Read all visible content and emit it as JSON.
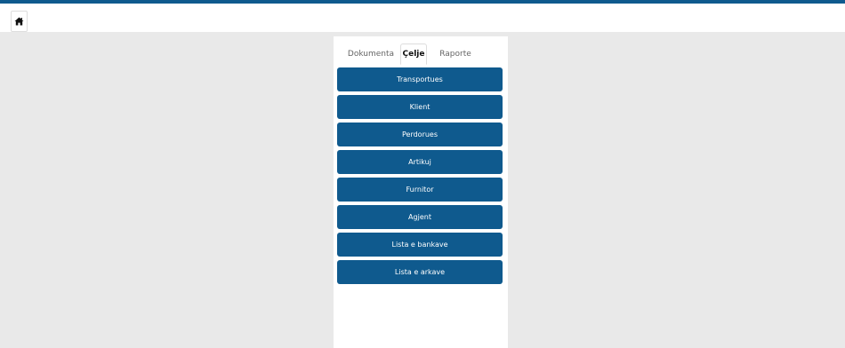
{
  "colors": {
    "accent": "#0f5a8e",
    "button_bg": "#0f5a8e",
    "page_bg": "#e9e9e9"
  },
  "header": {
    "home_icon": "home-icon"
  },
  "tabs": [
    {
      "label": "Dokumenta",
      "active": false
    },
    {
      "label": "Çelje",
      "active": true
    },
    {
      "label": "Raporte",
      "active": false
    }
  ],
  "menu": [
    {
      "label": "Transportues"
    },
    {
      "label": "Klient"
    },
    {
      "label": "Perdorues"
    },
    {
      "label": "Artikuj"
    },
    {
      "label": "Furnitor"
    },
    {
      "label": "Agjent"
    },
    {
      "label": "Lista e bankave"
    },
    {
      "label": "Lista e arkave"
    }
  ]
}
